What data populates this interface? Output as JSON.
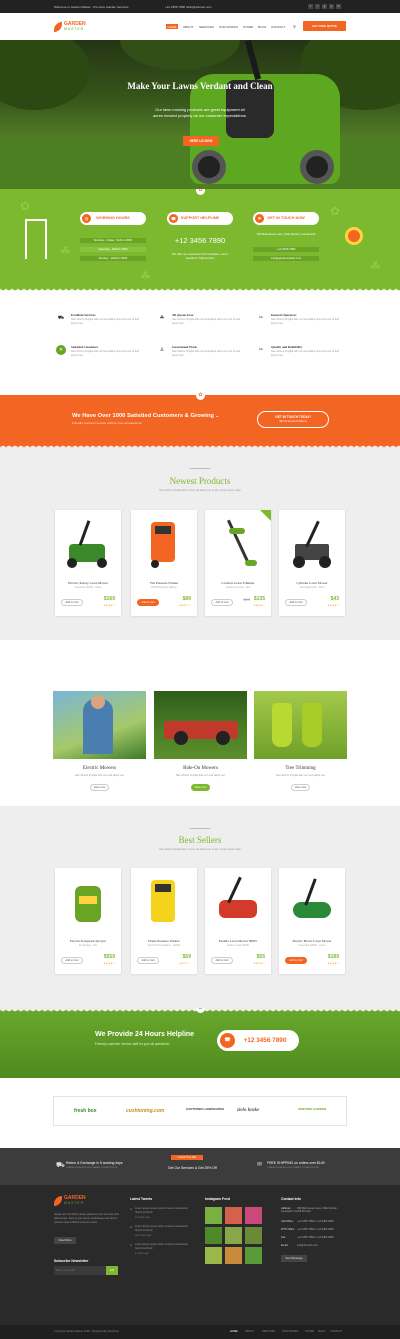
{
  "topbar": {
    "welcome": "Welcome to Garden Master · Premium Garden Services",
    "contacts": "+12 3456 7890   hello@domain.com",
    "social": [
      "f",
      "t",
      "g",
      "p",
      "in"
    ]
  },
  "header": {
    "logo_top": "GARDEN",
    "logo_bottom": "MASTER",
    "nav": [
      "HOME",
      "ABOUT",
      "SERVICES",
      "OUR WORKS",
      "STORE",
      "BLOG",
      "CONTACT"
    ],
    "quote_button": "GET FREE QUOTE"
  },
  "hero": {
    "title": "Make Your Lawns Verdant and Clean",
    "text": "Our lawn mowing products are great equipment all acres mowed properly as our customer expectations.",
    "cta": "HERE US NOW"
  },
  "info": {
    "hours_title": "WORKING HOURS",
    "hours": [
      "Monday - Friday : 9AM to 8PM",
      "Saturday : 9AM to 6PM",
      "Sunday : 10AM to 5PM"
    ],
    "helpline_title": "SUPPORT HELPLINE",
    "helpline_phone": "+12 3456 7890",
    "helpline_text": "We offer our customers 24 hrs helpline. Got a question? Call Us Now",
    "touch_title": "GET IN TOUCH NOW",
    "address": "390 Bell House Lane, NSE Denton, Ireland.ank",
    "touch_phone": "+12 3456 7890",
    "email": "info@gardenmaster.com"
  },
  "features": [
    {
      "title": "Excellent Services",
      "text": "Nam liberto fringilla felis orci sed aliqut duis urna nisi ut sed ipsum nec",
      "icon": "wheelbarrow-icon"
    },
    {
      "title": "All Quotes Free",
      "text": "Nam liberto fringilla felis orci sed aliqut duis urna nisi ut sed ipsum nec",
      "icon": "seedling-icon"
    },
    {
      "title": "Insured Operators",
      "text": "Nam liberto fringilla felis orci sed aliqut duis urna nisi ut sed ipsum nec",
      "icon": "pruner-icon"
    },
    {
      "title": "Satisfied Customers",
      "text": "Nam liberto fringilla felis orci sed aliqut duis urna nisi ut sed ipsum nec",
      "icon": "sun-icon"
    },
    {
      "title": "Guaranteed Work",
      "text": "Nam liberto fringilla felis orci sed aliqut duis urna nisi ut sed ipsum nec",
      "icon": "worker-icon"
    },
    {
      "title": "Quality and Reliability",
      "text": "Nam liberto fringilla felis orci sed aliqut duis urna nisi ut sed ipsum nec",
      "icon": "shears-icon"
    }
  ],
  "promo": {
    "title": "We Have Over 1000 Satistied Customers & Growing ..",
    "text": "Friendly customer service staff for your all questions!",
    "button": "GET IN TOUCH TODAY!",
    "button_sub": "We'll fix all your Problems"
  },
  "newest": {
    "title": "Newest Products",
    "subtitle": "Nam liberto fringilla felis. Fusce elit aliqut nec ut sim ornare ipsum vitae",
    "products": [
      {
        "name": "Electric Rotary Lawn Mower",
        "meta": "Greenland 1400W · Yellow",
        "price": "$169",
        "old": "",
        "button": "Add to Cart",
        "hl": false,
        "stars": "★★★★☆"
      },
      {
        "name": "Yex Pressure Washer",
        "meta": "1800W Pressure Washer",
        "price": "$89",
        "old": "",
        "button": "Add to Cart",
        "hl": true,
        "stars": "★★★☆☆"
      },
      {
        "name": "Cordless Grass Trimmer",
        "meta": "Grassmart a pure · Red",
        "price": "$135",
        "old": "$99",
        "button": "Add to Cart",
        "hl": false,
        "stars": "★★★★☆"
      },
      {
        "name": "Cylinder Lawn Mower",
        "meta": "Greenleigh Push · 30cm",
        "price": "$43",
        "old": "",
        "button": "Add to Cart",
        "hl": false,
        "stars": "★★★★☆"
      }
    ]
  },
  "categories": [
    {
      "title": "Electric Mowers",
      "text": "Nam liberto fringilla felis orci sed aliqut nec",
      "button": "View more",
      "hl": false
    },
    {
      "title": "Ride-On Mowers",
      "text": "Nam liberto fringilla felis orci sed aliqut nec",
      "button": "View more",
      "hl": true
    },
    {
      "title": "Tree Trimming",
      "text": "Nam liberto fringilla felis orci sed aliqut nec",
      "button": "View more",
      "hl": false
    }
  ],
  "best": {
    "title": "Best Sellers",
    "subtitle": "Nam liberto fringilla felis. Fusce elit aliqut nec ut sim ornare ipsum vitae",
    "products": [
      {
        "name": "Electric Knapsack Sprayer",
        "meta": "Pro Sprayer · 16L",
        "price": "$559",
        "old": "",
        "button": "Add to Cart",
        "hl": false,
        "stars": "★★★★☆"
      },
      {
        "name": "Home Pressure Washer",
        "meta": "Karcher Home Washer · 1400W",
        "price": "$59",
        "old": "",
        "button": "Add to Cart",
        "hl": false,
        "stars": "★★★☆☆"
      },
      {
        "name": "Easimo Lawn Mower 800W",
        "meta": "Garden mower 800W",
        "price": "$55",
        "old": "",
        "button": "Add to Cart",
        "hl": false,
        "stars": "★★★★☆"
      },
      {
        "name": "Electric Hover Lawn Mower",
        "meta": "Greenland 1400W · Green",
        "price": "$189",
        "old": "",
        "button": "Add to Cart",
        "hl": true,
        "stars": "★★★★☆"
      }
    ]
  },
  "help": {
    "title": "We Provide 24 Hours Helpline",
    "text": "Friendly customer service staff for your all questions!",
    "phone": "+12 3456 7890"
  },
  "brands": [
    "fresh box",
    "cushioning.com",
    "CAPTURED LANDSCAPES",
    "zielo krake",
    "VENTURE GARDEN"
  ],
  "services": [
    {
      "title": "Return & Exchange in 5 working days",
      "text": "LOREM IPSUM DOLOR SIT AMET CONSECTETUR"
    },
    {
      "title": "Get Our Services & Get 25% Off",
      "badge": "Limited Time offer"
    },
    {
      "title": "FREE SHIPPING on orders over $149",
      "text": "LOREM IPSUM DOLOR SIT AMET CONSECTETUR"
    }
  ],
  "footer": {
    "logo_top": "GARDEN",
    "logo_bottom": "MASTER",
    "about": "Neque arcu hendrerit neque pharetra nunc vel risus velit ullamcorper. Duis ut quis ipsum scelerisque erat. Enum posuere quam efficitur tempus ornare.",
    "read_more": "Read More",
    "newsletter_title": "Subscribe Newsletter",
    "newsletter_placeholder": "Enter your email",
    "newsletter_button": "GO",
    "tweets_title": "Latest Tweets",
    "tweets": [
      {
        "text": "Lorem ipsum ipsum dolor sit amet consectetur http://t.co/JCe4",
        "time": "2 minute ago"
      },
      {
        "text": "Lorem ipsum ipsum dolor sit amet consectetur http://t.co/JCe4",
        "time": "46 minute ago"
      },
      {
        "text": "Lorem ipsum ipsum dolor sit amet consectetur http://t.co/JCe4",
        "time": "1 hours ago"
      }
    ],
    "instagram_title": "Instagram Feed",
    "contact_title": "Contact Info",
    "contacts": [
      {
        "label": "Address:",
        "value": "390 Bell House Lane, NSE Denton, Ameriland, Ca 68 95 USA"
      },
      {
        "label": "Call Office:",
        "value": "+12 3456 7890 / +12 3456 0987"
      },
      {
        "label": "WTP Office:",
        "value": "+12 3456 7890 / +12 3456 0987"
      },
      {
        "label": "Fax:",
        "value": "+12 3456 7890 / +12 3456 0987"
      },
      {
        "label": "Email:",
        "value": "info@domain.com"
      }
    ],
    "send_button": "Send Message"
  },
  "copyright": {
    "text": "Copyright Garden Master 2018  ·  Designed By Templines",
    "nav": [
      "HOME",
      "ABOUT",
      "SERVICES",
      "OUR WORKS",
      "STORE",
      "BLOG",
      "CONTACT"
    ]
  },
  "colors": {
    "accent": "#f26522",
    "green": "#7cb92f",
    "dark": "#2a2a2a"
  }
}
